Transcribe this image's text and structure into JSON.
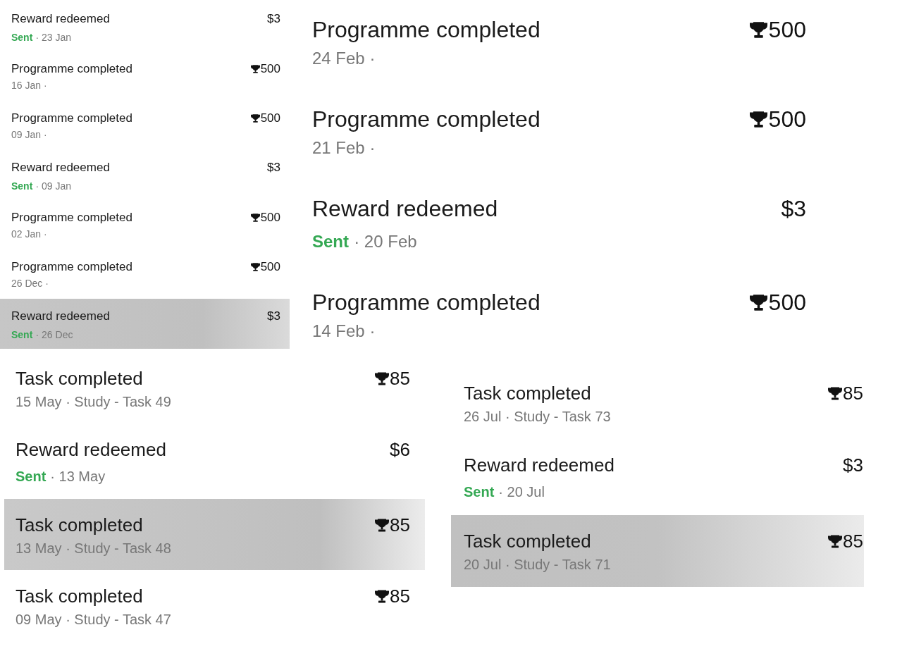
{
  "panels": [
    {
      "rows": [
        {
          "kind": "reward",
          "title": "Reward redeemed",
          "amount": "$3",
          "status": "Sent",
          "subtitle": "· 23 Jan",
          "selected": false
        },
        {
          "kind": "points",
          "title": "Programme completed",
          "amount": "500",
          "subtitle": "16 Jan ·",
          "selected": false
        },
        {
          "kind": "points",
          "title": "Programme completed",
          "amount": "500",
          "subtitle": "09 Jan ·",
          "selected": false
        },
        {
          "kind": "reward",
          "title": "Reward redeemed",
          "amount": "$3",
          "status": "Sent",
          "subtitle": "· 09 Jan",
          "selected": false
        },
        {
          "kind": "points",
          "title": "Programme completed",
          "amount": "500",
          "subtitle": "02 Jan ·",
          "selected": false
        },
        {
          "kind": "points",
          "title": "Programme completed",
          "amount": "500",
          "subtitle": "26 Dec ·",
          "selected": false
        },
        {
          "kind": "reward",
          "title": "Reward redeemed",
          "amount": "$3",
          "status": "Sent",
          "subtitle": "· 26 Dec",
          "selected": true
        }
      ]
    },
    {
      "rows": [
        {
          "kind": "points",
          "title": "Programme completed",
          "amount": "500",
          "subtitle": "24 Feb ·",
          "selected": false
        },
        {
          "kind": "points",
          "title": "Programme completed",
          "amount": "500",
          "subtitle": "21 Feb ·",
          "selected": false
        },
        {
          "kind": "reward",
          "title": "Reward redeemed",
          "amount": "$3",
          "status": "Sent",
          "subtitle": "· 20 Feb",
          "selected": false
        },
        {
          "kind": "points",
          "title": "Programme completed",
          "amount": "500",
          "subtitle": "14 Feb ·",
          "selected": false
        }
      ]
    },
    {
      "rows": [
        {
          "kind": "points",
          "title": "Task completed",
          "amount": "85",
          "subtitle": "15 May · Study - Task 49",
          "selected": false
        },
        {
          "kind": "reward",
          "title": "Reward redeemed",
          "amount": "$6",
          "status": "Sent",
          "subtitle": "· 13 May",
          "selected": false
        },
        {
          "kind": "points",
          "title": "Task completed",
          "amount": "85",
          "subtitle": "13 May · Study - Task 48",
          "selected": true
        },
        {
          "kind": "points",
          "title": "Task completed",
          "amount": "85",
          "subtitle": "09 May · Study - Task 47",
          "selected": false
        }
      ]
    },
    {
      "rows": [
        {
          "kind": "points",
          "title": "Task completed",
          "amount": "85",
          "subtitle": "26 Jul · Study - Task 73",
          "selected": false
        },
        {
          "kind": "reward",
          "title": "Reward redeemed",
          "amount": "$3",
          "status": "Sent",
          "subtitle": "· 20 Jul",
          "selected": false
        },
        {
          "kind": "points",
          "title": "Task completed",
          "amount": "85",
          "subtitle": "20 Jul · Study - Task 71",
          "selected": true
        }
      ]
    }
  ]
}
